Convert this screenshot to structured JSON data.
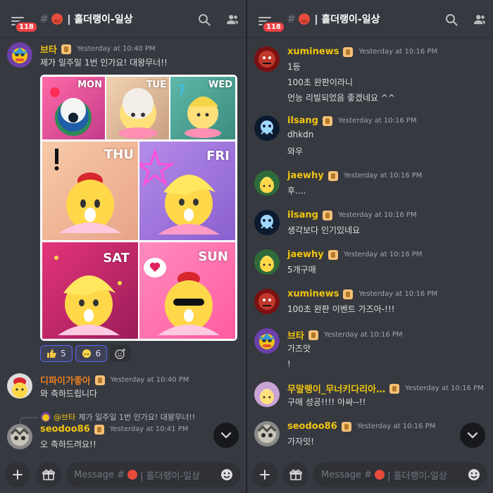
{
  "colors": {
    "background": "#36393f",
    "accent_blurple": "#5865f2",
    "badge_red": "#ed4245",
    "name_yellow": "#f1c40f",
    "name_orange": "#e67e22",
    "timestamp": "#a3a6aa"
  },
  "left": {
    "header": {
      "badge_count": "118",
      "hash": "#",
      "channel_name": "| 홀더랭이-일상",
      "icons": [
        "menu-icon",
        "octopus-emoji-icon",
        "search-icon",
        "members-icon"
      ]
    },
    "messages": [
      {
        "author": "브타",
        "timestamp": "Yesterday at 10:40 PM",
        "text": "제가 일주일 1번 인가요! 대왕무너!!",
        "attachment_labels": [
          "MON",
          "TUE",
          "WED",
          "THU",
          "FRI",
          "SAT",
          "SUN"
        ],
        "reactions": [
          {
            "emoji": "thumbs-up-icon",
            "count": "5"
          },
          {
            "emoji": "octopus-face-icon",
            "count": "6"
          }
        ],
        "add_reaction_icon": "add-reaction-icon"
      },
      {
        "author": "디파이가좋아",
        "timestamp": "Yesterday at 10:40 PM",
        "text": "와 축하드립니다"
      },
      {
        "reply_to_author": "@브타",
        "reply_to_text": "제가 일주일 1번 인가요! 대왕무너!!",
        "author": "seodoo86",
        "timestamp": "Yesterday at 10:41 PM",
        "text": "오 축하드려요!!"
      }
    ],
    "composer": {
      "placeholder_prefix": "Message #",
      "placeholder_suffix": "| 홀더랭이-일상"
    }
  },
  "right": {
    "header": {
      "badge_count": "118",
      "hash": "#",
      "channel_name": "| 홀더랭이-일상"
    },
    "messages": [
      {
        "author": "xuminews",
        "timestamp": "Yesterday at 10:16 PM",
        "lines": [
          "1등",
          "100초 완판이라니",
          "언능 리빌되었음 좋겠네요 ^^"
        ]
      },
      {
        "author": "ilsang",
        "timestamp": "Yesterday at 10:16 PM",
        "lines": [
          "dhkdn",
          "와우"
        ]
      },
      {
        "author": "jaewhy",
        "timestamp": "Yesterday at 10:16 PM",
        "lines": [
          "후...."
        ]
      },
      {
        "author": "ilsang",
        "timestamp": "Yesterday at 10:16 PM",
        "lines": [
          "생각보다 인기있네요"
        ]
      },
      {
        "author": "jaewhy",
        "timestamp": "Yesterday at 10:16 PM",
        "lines": [
          "5개구매"
        ]
      },
      {
        "author": "xuminews",
        "timestamp": "Yesterday at 10:16 PM",
        "lines": [
          "100초 완판 이벤트 가즈아-!!!"
        ]
      },
      {
        "author": "브타",
        "timestamp": "Yesterday at 10:16 PM",
        "lines": [
          "가즈앗",
          "!"
        ]
      },
      {
        "author": "무말랭이_무너키다리아…",
        "timestamp": "Yesterday at 10:16 PM",
        "lines": [
          "구매 성공!!!! 아싸--!!"
        ]
      },
      {
        "author": "seodoo86",
        "timestamp": "Yesterday at 10:16 PM",
        "lines": [
          "가자잇!"
        ]
      }
    ],
    "composer": {
      "placeholder_prefix": "Message #",
      "placeholder_suffix": "| 홀더랭이-일상"
    }
  }
}
